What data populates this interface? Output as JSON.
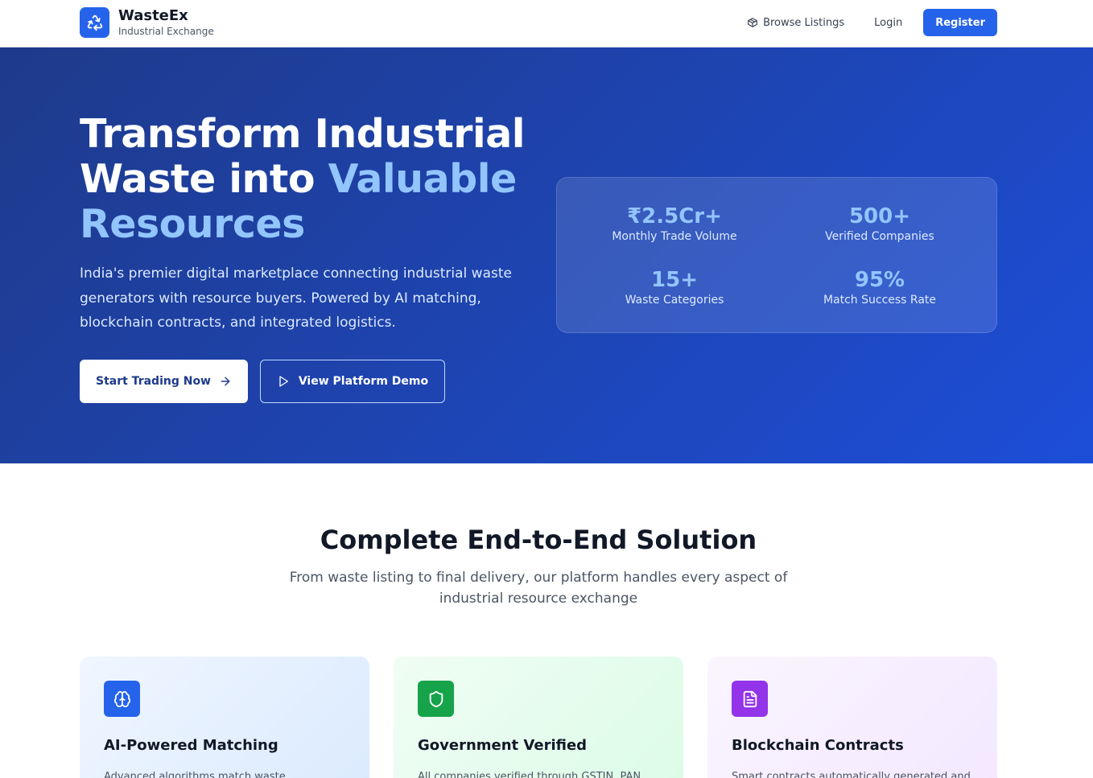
{
  "nav": {
    "brand_name": "WasteEx",
    "brand_sub": "Industrial Exchange",
    "browse_label": "Browse Listings",
    "login_label": "Login",
    "register_label": "Register"
  },
  "hero": {
    "title_line1": "Transform Industrial",
    "title_line2a": "Waste into ",
    "title_line2b": "Valuable",
    "title_line3": "Resources",
    "description": "India's premier digital marketplace connecting industrial waste generators with resource buyers. Powered by AI matching, blockchain contracts, and integrated logistics.",
    "start_button": "Start Trading Now",
    "demo_button": "View Platform Demo"
  },
  "stats": [
    {
      "value": "₹2.5Cr+",
      "label": "Monthly Trade Volume"
    },
    {
      "value": "500+",
      "label": "Verified Companies"
    },
    {
      "value": "15+",
      "label": "Waste Categories"
    },
    {
      "value": "95%",
      "label": "Match Success Rate"
    }
  ],
  "solution": {
    "title": "Complete End-to-End Solution",
    "subtitle": "From waste listing to final delivery, our platform handles every aspect of industrial resource exchange"
  },
  "cards": [
    {
      "title": "AI-Powered Matching",
      "text": "Advanced algorithms match waste",
      "icon": "brain-icon"
    },
    {
      "title": "Government Verified",
      "text": "All companies verified through GSTIN, PAN",
      "icon": "shield-icon"
    },
    {
      "title": "Blockchain Contracts",
      "text": "Smart contracts automatically generated and",
      "icon": "document-icon"
    }
  ],
  "colors": {
    "primary": "#2563eb",
    "hero_start": "#1e3a8a",
    "hero_end": "#1d4ed8",
    "accent_light": "#93c5fd",
    "green": "#16a34a",
    "purple": "#9333ea"
  }
}
